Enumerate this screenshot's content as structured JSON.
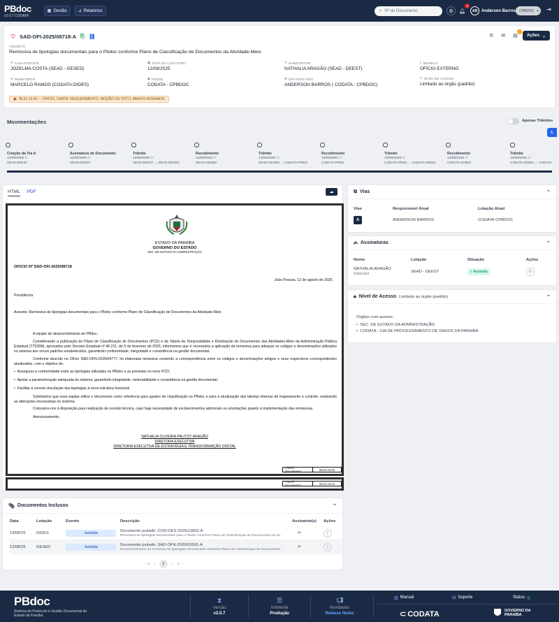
{
  "topbar": {
    "logo": "PBdoc",
    "version": "v2.0.7 CODATA",
    "nav": [
      {
        "label": "Gestão",
        "icon": "grid-icon"
      },
      {
        "label": "Relatórios",
        "icon": "chart-icon"
      }
    ],
    "search_placeholder": "Nº do Documento",
    "notifications_count": "3",
    "user_initials": "AB",
    "user_name": "Anderson Barros",
    "org": "CPBDOC"
  },
  "document": {
    "code": "SAD-OFI-2025/08718-A",
    "assunto_label": "ASSUNTO",
    "assunto": "Remissiva de tipologias documentais para o Pbdoc conforme Plano de Classificação de Documentos da Atividade-Meio.",
    "actions_label": "Ações",
    "actions_badge": "2",
    "fields": [
      {
        "label": "CADASTRANTE",
        "value": "JOZELMA COSTA (SEAD - GESED)"
      },
      {
        "label": "DATA DO CADASTRO",
        "value": "12/08/2025"
      },
      {
        "label": "SUBSCRITOR",
        "value": "NATHALIA ARAGÃO (SEAD - DEEST)"
      },
      {
        "label": "MODELO",
        "value": "OFÍCIO EXTERNO"
      },
      {
        "label": "REMETENTE",
        "value": "MARCELO RAMOS (CODATA-DIDES)"
      },
      {
        "label": "POSSE",
        "value": "CODATA - CPBDOC"
      },
      {
        "label": "DESTINATÁRIO",
        "value": "ANDERSON BARROS ( CODATA - CPBDOC)"
      },
      {
        "label": "NÍVEL DE ACESSO",
        "value": "Limitado ao órgão (padrão)"
      }
    ],
    "classification": "06.01.10.03 — OFÍCIO, CARTA, REQUERIMENTO, MOÇÃO OU VOTO, ABAIXO-ASSINADO"
  },
  "movimentacoes": {
    "title": "Movimentações",
    "toggle_label": "Apenas Trâmites",
    "items": [
      {
        "name": "Criação da Via A",
        "date": "12/08/2025",
        "org": "SEAD-DEEST"
      },
      {
        "name": "Assinatura de Documento",
        "date": "12/08/2025",
        "org": "SEAD-DEEST"
      },
      {
        "name": "Trâmite",
        "date": "12/08/2025",
        "org": "SEAD-DEEST → SEAD-GESED"
      },
      {
        "name": "Recebimento",
        "date": "12/08/2025",
        "org": "SEAD-GESED"
      },
      {
        "name": "Trâmite",
        "date": "12/08/2025",
        "org": "SEAD-GESED → CODATA-PRES"
      },
      {
        "name": "Recebimento",
        "date": "13/08/2025",
        "org": "CODATA-PRES"
      },
      {
        "name": "Trâmite",
        "date": "13/08/2025",
        "org": "CODATA-PRES → CODATA-DIDES"
      },
      {
        "name": "Recebimento",
        "date": "13/08/2025",
        "org": "CODATA-DIDES"
      },
      {
        "name": "Trâmite",
        "date": "13/08/2025",
        "org": "CODATA-DIDES → CODATA"
      }
    ]
  },
  "viewer": {
    "tab_html": "HTML",
    "tab_pdf": "PDF",
    "letter": {
      "header1": "ESTADO DA PARAÍBA",
      "header2": "GOVERNO DO ESTADO",
      "header3": "SEC. DE ESTADO DA ADMINISTRAÇÃO",
      "number": "OFICIO Nº SAD-OFI-2025/08718",
      "place_date": "João Pessoa, 12 de agosto de 2025.",
      "recipient": "Presidência",
      "subject": "Assunto: Remissiva de tipologias documentais para o Pbdoc conforme Plano de Classificação de Documentos da Atividade-Meio",
      "greeting": "A equipe de desenvolvimento do PBdoc,",
      "p1": "Considerando a publicação do Plano de Classificação de Documentos (PCD) e da Tabela de Temporalidade e Destinação de Documentos das Atividades-Meio da Administração Pública Estadual (TTDDM), aprovados pelo Decreto Estadual nº 46.211, de 5 de fevereiro de 2025, informamos que é necessária a aplicação da remissiva para adequar os códigos e denominações utilizados no sistema aos novos padrões estabelecidos, garantindo conformidade, integridade e consistência na gestão documental.",
      "p2": "Conforme descrito no Ofício SAD-OFN-2025/04777, foi elaborada remissiva contendo a correspondência entre os códigos e denominações antigos e seus respectivos correspondentes atualizados, com o objetivo de:",
      "bullets": [
        "Assegurar a conformidade entre as tipologias utilizadas no PBdoc e as previstas no novo PCD;",
        "Apoiar a parametrização adequada do sistema, garantindo integridade, rastreabilidade e consistência na gestão documental;",
        "Facilitar a correta vinculação das tipologias à nova estrutura funcional."
      ],
      "p3": "Solicitamos que essa equipe utilize o documento como referência para ajustes de classificação no PBdoc e para a atualização das tabelas internas de mapeamento e controle, realizando as alterações necessárias no sistema.",
      "p4": "Colocamo-nos à disposição para realização de reunião técnica, caso haja necessidade de esclarecimentos adicionais ou orientações quanto à implementação das remissivas.",
      "closing": "Atenciosamente,",
      "sig1": "NATHALIA OLIVEIRA PALITOT ARAGÃO",
      "sig2": "DIRETORA EXECUTIVA",
      "sig3": "DIRETORIA EXECUTIVA DE ESTRATÉGIA E TRANSFORMAÇÃO DIGITAL",
      "class_label": "Classif. Documental",
      "class_code": "06.01.10.03"
    }
  },
  "vias": {
    "title": "Vias",
    "headers": [
      "Vias",
      "Responsável Atual",
      "Lotação Atual"
    ],
    "rows": [
      {
        "via": "A",
        "responsavel": "ANDERSON BARROS",
        "lotacao": "CODATA-CPBDOC"
      }
    ]
  },
  "assinaturas": {
    "title": "Assinaturas",
    "headers": [
      "Nome",
      "Lotação",
      "Situação",
      "Ações"
    ],
    "rows": [
      {
        "nome": "NATHÁLIA ARAGÃO",
        "papel": "Subscritor",
        "lotacao": "SEAD - DEEST",
        "situacao": "Assinado"
      }
    ]
  },
  "nivel": {
    "title": "Nível de Acesso",
    "subtitle": "Limitado ao órgão (padrão)",
    "orgs_label": "Órgãos com acesso:",
    "orgs": [
      "SEC. DE ESTADO DA ADMINISTRAÇÃO",
      "CODATA - CIA DE PROCESSAMENTO DE DADOS DA PARAIBA"
    ]
  },
  "docs_incluidos": {
    "title": "Documentos Inclusos",
    "headers": [
      "Data",
      "Lotação",
      "Evento",
      "Descrição",
      "Assinante(s)",
      "Ações"
    ],
    "rows": [
      {
        "data": "13/08/25",
        "lotacao": "DIDES",
        "evento": "Juntada",
        "titulo": "Documento juntado: COD-DES-2025/13602-A",
        "resumo": "Remissiva de tipologias documentais para o Pbdoc conforme Plano de Classificação de Documentos da Ati..."
      },
      {
        "data": "12/08/25",
        "lotacao": "GESED",
        "evento": "Juntada",
        "titulo": "Documento juntado: SAD-OFN-2025/03591-A",
        "resumo": "Encaminhamento de remissiva de tipologias documentais conforme Plano de Classificação de Documentos..."
      }
    ],
    "page": "1"
  },
  "footer": {
    "tagline": "Sistema de Protocolo e Gestão Documental do Estado da Paraíba",
    "versao_label": "Versão",
    "versao": "v2.0.7",
    "ambiente_label": "Ambiente",
    "ambiente": "Produção",
    "novidades_label": "Novidades",
    "novidades": "Release Notes",
    "manual": "Manual",
    "suporte": "Suporte",
    "status": "Status",
    "codata": "CODATA",
    "gov": "GOVERNO DA PARAÍBA"
  }
}
